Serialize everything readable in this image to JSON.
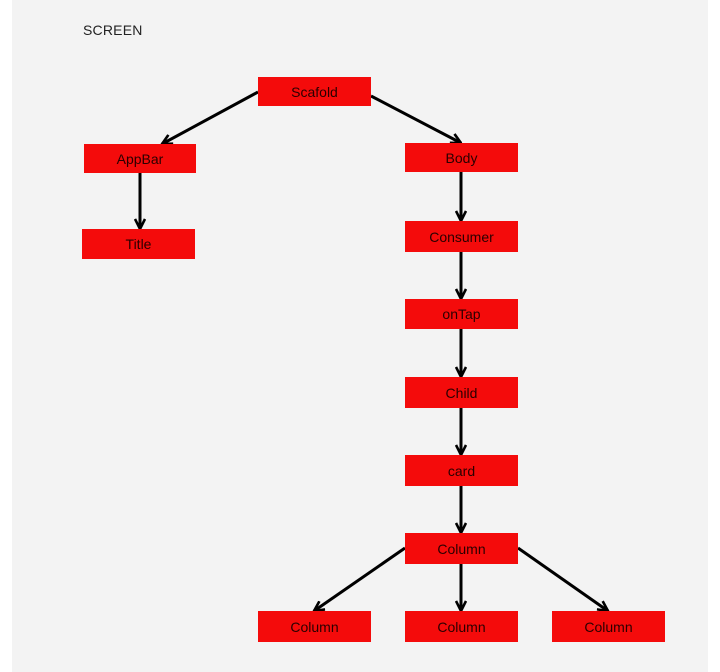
{
  "screen_label": "SCREEN",
  "node_color": "#f40b0b",
  "edge_color": "#000000",
  "background_color": "#f3f3f3",
  "nodes": {
    "scaffold": "Scafold",
    "appbar": "AppBar",
    "title": "Title",
    "body": "Body",
    "consumer": "Consumer",
    "ontap": "onTap",
    "child": "Child",
    "card": "card",
    "column": "Column",
    "column_left": "Column",
    "column_mid": "Column",
    "column_right": "Column"
  },
  "edges": [
    [
      "scaffold",
      "appbar"
    ],
    [
      "scaffold",
      "body"
    ],
    [
      "appbar",
      "title"
    ],
    [
      "body",
      "consumer"
    ],
    [
      "consumer",
      "ontap"
    ],
    [
      "ontap",
      "child"
    ],
    [
      "child",
      "card"
    ],
    [
      "card",
      "column"
    ],
    [
      "column",
      "column_left"
    ],
    [
      "column",
      "column_mid"
    ],
    [
      "column",
      "column_right"
    ]
  ]
}
